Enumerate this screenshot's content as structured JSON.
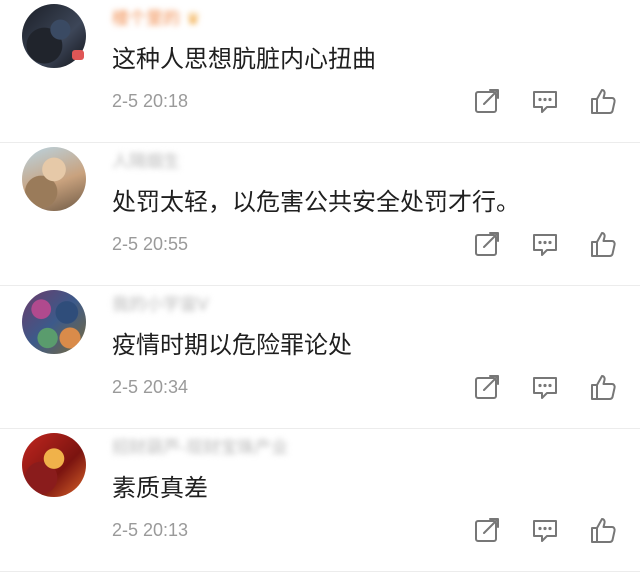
{
  "comments": [
    {
      "username": "楼个里的",
      "text": "这种人思想肮脏内心扭曲",
      "time": "2-5 20:18"
    },
    {
      "username": "人隔烟生",
      "text": "处罚太轻，以危害公共安全处罚才行。",
      "time": "2-5 20:55"
    },
    {
      "username": "我的小宇宙V",
      "text": "疫情时期以危险罪论处",
      "time": "2-5 20:34"
    },
    {
      "username": "招财葫芦-现财宝珠产业",
      "text": "素质真差",
      "time": "2-5 20:13"
    }
  ],
  "colors": {
    "username_vip": "#f08a4b",
    "username_normal": "#b8b8b8",
    "time": "#9a9a9a",
    "icon": "#777777"
  },
  "icons": {
    "share": "share-icon",
    "reply": "comment-icon",
    "like": "thumbs-up-icon"
  }
}
